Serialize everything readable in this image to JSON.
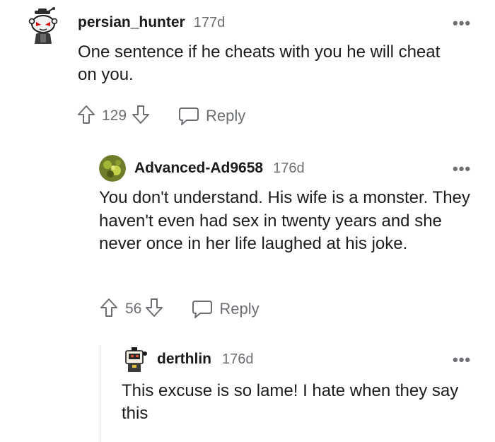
{
  "comments": [
    {
      "username": "persian_hunter",
      "age": "177d",
      "body": "One sentence if he cheats with you he will cheat on you.",
      "votes": "129",
      "reply_label": "Reply",
      "avatar_icon": "snoo-red-eyes-avatar"
    },
    {
      "username": "Advanced-Ad9658",
      "age": "176d",
      "body": "You don't understand. His wife is a monster. They haven't even had sex in twenty years and she never once in her life laughed at his joke.",
      "votes": "56",
      "reply_label": "Reply",
      "avatar_icon": "green-leaf-avatar"
    },
    {
      "username": "derthlin",
      "age": "176d",
      "body": "This excuse is so lame! I hate when they say this",
      "avatar_icon": "robot-avatar"
    }
  ],
  "more_icon": "more-options-icon",
  "colors": {
    "text": "#1a1a1b",
    "meta": "#6b6e72",
    "line": "#dadce0"
  }
}
